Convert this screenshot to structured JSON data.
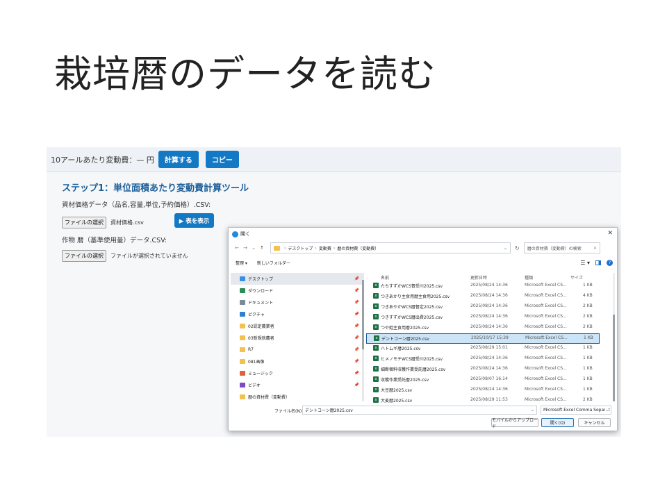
{
  "slide": {
    "title": "栽培暦のデータを読む"
  },
  "app": {
    "cost_label": "10アールあたり変動費：— 円",
    "calc_button": "計算する",
    "copy_button": "コピー",
    "step_title": "ステップ1：単位面積あたり変動費計算ツール",
    "price_label": "資材価格データ（品名,容量,単位,予約価格）.CSV:",
    "file_select_button": "ファイルの選択",
    "price_file_name": "資材価格.csv",
    "show_table_button": "▶ 表を表示",
    "calendar_label": "作物 暦（基準使用量）データ.CSV:",
    "calendar_file_status": "ファイルが選択されていません"
  },
  "dialog": {
    "title": "開く",
    "breadcrumb": [
      "デスクトップ",
      "変動費",
      "暦の資材費（変動費）"
    ],
    "search_placeholder": "暦の資材費（変動費）の検索",
    "toolbar": {
      "organize": "整理 ▾",
      "new_folder": "新しいフォルダー"
    },
    "nav_items": [
      {
        "label": "デスクトップ",
        "icon": "desktop-icon",
        "color": "#3a8ee6",
        "pinned": true,
        "selected": true
      },
      {
        "label": "ダウンロード",
        "icon": "download-icon",
        "color": "#2e8b57",
        "pinned": true,
        "selected": false
      },
      {
        "label": "ドキュメント",
        "icon": "document-icon",
        "color": "#7a8a99",
        "pinned": true,
        "selected": false
      },
      {
        "label": "ピクチャ",
        "icon": "picture-icon",
        "color": "#2f7fd1",
        "pinned": true,
        "selected": false
      },
      {
        "label": "02認定農業者",
        "icon": "folder-icon",
        "color": "#f2c14e",
        "pinned": true,
        "selected": false
      },
      {
        "label": "03新規就農者",
        "icon": "folder-icon",
        "color": "#f2c14e",
        "pinned": true,
        "selected": false
      },
      {
        "label": "R7",
        "icon": "folder-icon",
        "color": "#f2c14e",
        "pinned": true,
        "selected": false
      },
      {
        "label": "081画像",
        "icon": "folder-icon",
        "color": "#f2c14e",
        "pinned": true,
        "selected": false
      },
      {
        "label": "ミュージック",
        "icon": "music-icon",
        "color": "#e0603a",
        "pinned": true,
        "selected": false
      },
      {
        "label": "ビデオ",
        "icon": "video-icon",
        "color": "#7b4bc4",
        "pinned": true,
        "selected": false
      },
      {
        "label": "暦の資材費（変動費）",
        "icon": "folder-icon",
        "color": "#f2c14e",
        "pinned": false,
        "selected": false
      }
    ],
    "columns": {
      "name": "名前",
      "date": "更新日時",
      "type": "種類",
      "size": "サイズ"
    },
    "files": [
      {
        "name": "たちすずかWCS督受川2025.csv",
        "date": "2025/08/24 14:36",
        "type": "Microsoft Excel CS...",
        "size": "1 KB"
      },
      {
        "name": "つきあかり主食用暦主食用2025.csv",
        "date": "2025/08/24 14:36",
        "type": "Microsoft Excel CS...",
        "size": "4 KB"
      },
      {
        "name": "つきあやかWCS暦督定2025.csv",
        "date": "2025/08/24 14:36",
        "type": "Microsoft Excel CS...",
        "size": "2 KB"
      },
      {
        "name": "つきすずかWCS暦出費2025.csv",
        "date": "2025/08/24 14:36",
        "type": "Microsoft Excel CS...",
        "size": "2 KB"
      },
      {
        "name": "つや姫主食用暦2025.csv",
        "date": "2025/08/24 14:36",
        "type": "Microsoft Excel CS...",
        "size": "2 KB"
      },
      {
        "name": "デントコーン暦2025.csv",
        "date": "2025/10/17 15:39",
        "type": "Microsoft Excel CS...",
        "size": "1 KB",
        "selected": true
      },
      {
        "name": "ハトムギ暦2025.csv",
        "date": "2025/08/29 15:01",
        "type": "Microsoft Excel CS...",
        "size": "1 KB"
      },
      {
        "name": "ヒメノモチWCS暦受川2025.csv",
        "date": "2025/08/24 14:36",
        "type": "Microsoft Excel CS...",
        "size": "1 KB"
      },
      {
        "name": "細断梱料収穫作業受託暦2025.csv",
        "date": "2025/08/24 14:36",
        "type": "Microsoft Excel CS...",
        "size": "1 KB"
      },
      {
        "name": "収穫作業受託暦2025.csv",
        "date": "2025/08/07 16:14",
        "type": "Microsoft Excel CS...",
        "size": "1 KB"
      },
      {
        "name": "大豆暦2025.csv",
        "date": "2025/08/24 14:36",
        "type": "Microsoft Excel CS...",
        "size": "1 KB"
      },
      {
        "name": "大麦暦2025.csv",
        "date": "2025/08/29 11:53",
        "type": "Microsoft Excel CS...",
        "size": "2 KB"
      }
    ],
    "filename_label": "ファイル名(N):",
    "filename_value": "デントコーン暦2025.csv",
    "filetype_value": "Microsoft Excel Comma Separat",
    "upload_button": "モバイルからアップロード",
    "open_button": "開く(O)",
    "cancel_button": "キャンセル"
  }
}
